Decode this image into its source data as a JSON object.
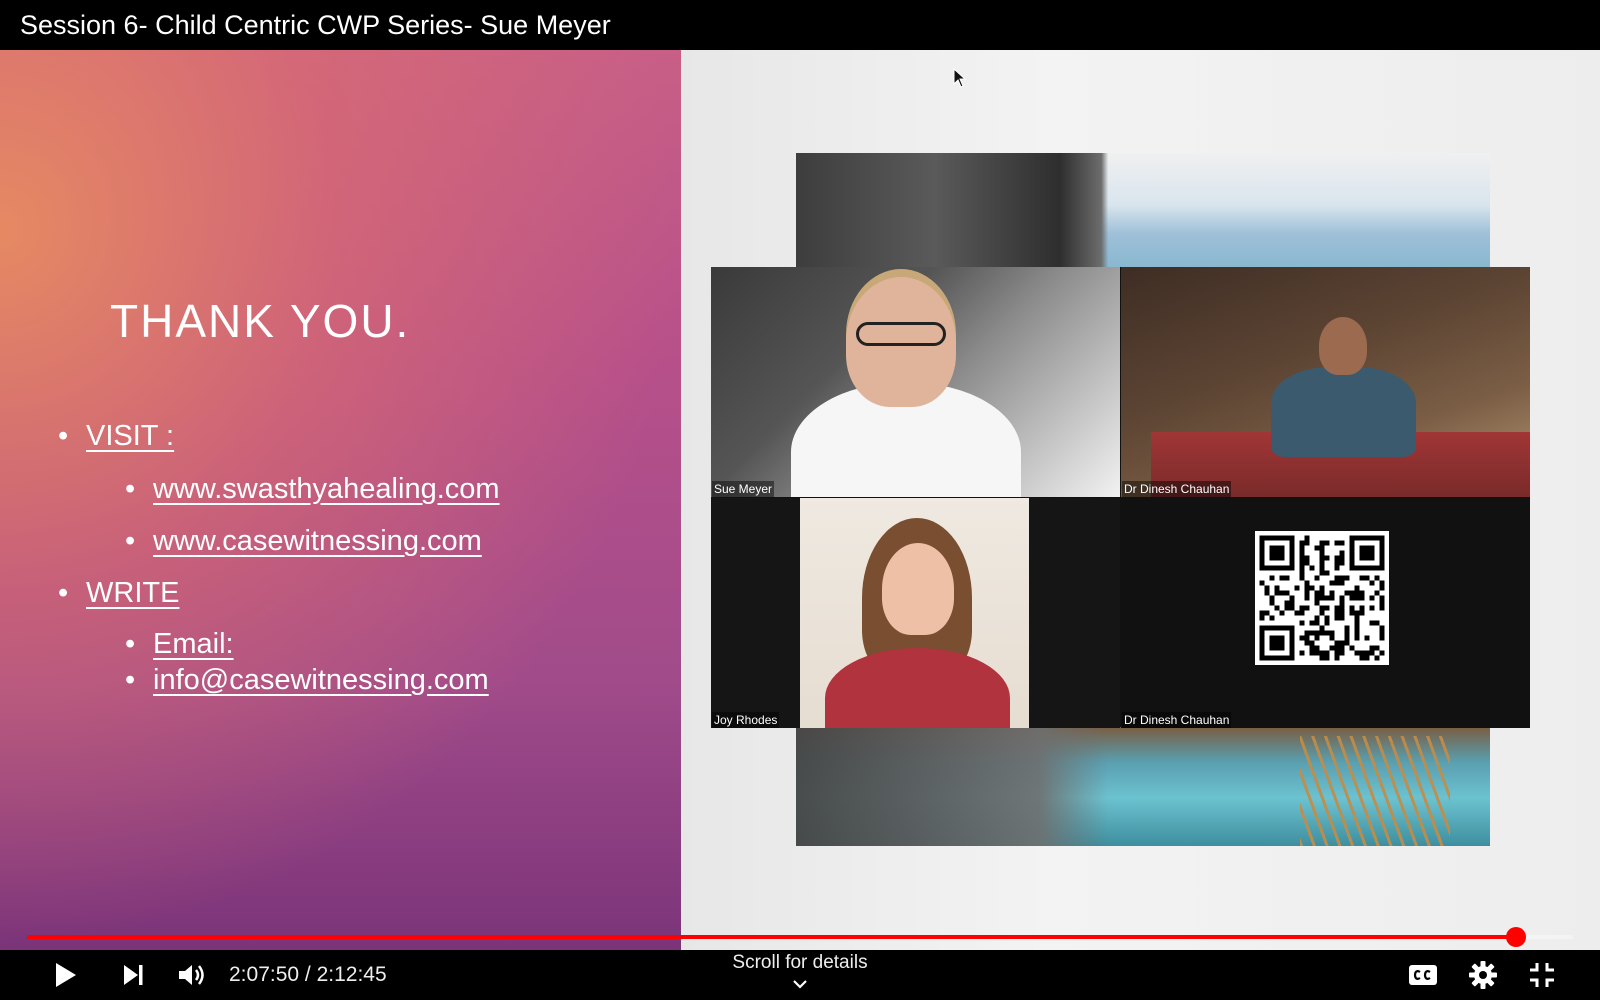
{
  "video": {
    "title": "Session 6- Child Centric CWP Series- Sue Meyer"
  },
  "slide": {
    "heading": "THANK YOU.",
    "bullets": {
      "visit": "VISIT :",
      "site1": "www.swasthyahealing.com",
      "site2": "www.casewitnessing.com",
      "write": "WRITE",
      "email_label": "Email:",
      "email": "info@casewitnessing.com"
    }
  },
  "participants": {
    "sue": "Sue Meyer",
    "dinesh_video": "Dr Dinesh Chauhan",
    "joy": "Joy Rhodes",
    "dinesh_qr": "Dr Dinesh Chauhan"
  },
  "player": {
    "current_time": "2:07:50",
    "time_separator": " / ",
    "duration": "2:12:45",
    "progress_fraction": 0.963,
    "scroll_hint": "Scroll for details",
    "accent_color": "#ff0000"
  },
  "icons": {
    "play": "play-icon",
    "next": "next-icon",
    "volume": "volume-icon",
    "captions": "captions-icon",
    "settings": "gear-icon",
    "exit_fullscreen": "exit-fullscreen-icon",
    "scroll_down": "chevron-down-icon",
    "cursor": "mouse-cursor-icon",
    "qr": "qr-code-icon"
  }
}
